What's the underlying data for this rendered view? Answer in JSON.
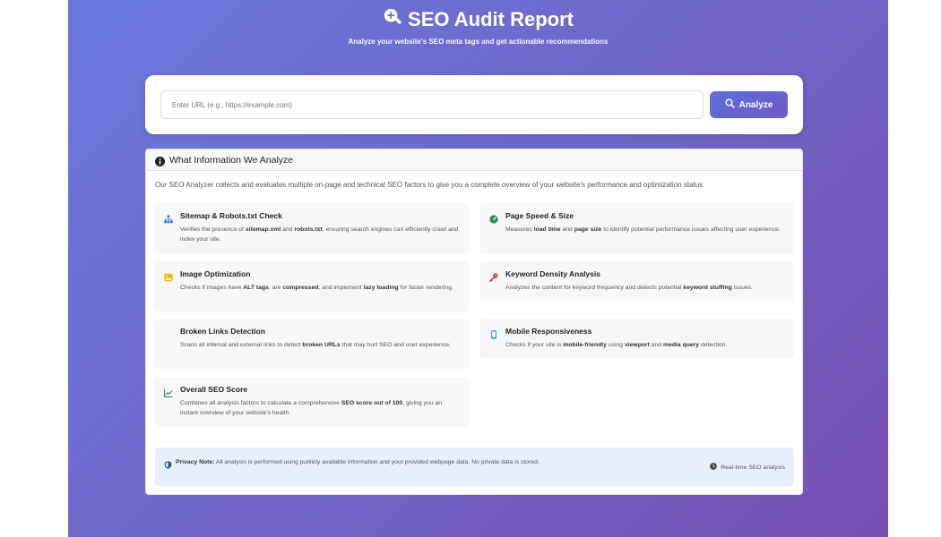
{
  "header": {
    "title": "SEO Audit Report",
    "subtitle": "Analyze your website's SEO meta tags and get actionable recommendations"
  },
  "search": {
    "placeholder": "Enter URL (e.g., https://example.com)",
    "value": "",
    "button_label": "Analyze"
  },
  "info": {
    "heading": "What Information We Analyze",
    "intro": "Our SEO Analyzer collects and evaluates multiple on-page and technical SEO factors to give you a complete overview of your website's performance and optimization status.",
    "features": [
      {
        "title": "Sitemap & Robots.txt Check",
        "desc_parts": [
          "Verifies the presence of ",
          "sitemap.xml",
          " and ",
          "robots.txt",
          ", ensuring search engines can efficiently crawl and index your site."
        ],
        "icon": "sitemap-icon"
      },
      {
        "title": "Page Speed & Size",
        "desc_parts": [
          "Measures ",
          "load time",
          " and ",
          "page size",
          " to identify potential performance issues affecting user experience."
        ],
        "icon": "speed-icon"
      },
      {
        "title": "Image Optimization",
        "desc_parts": [
          "Checks if images have ",
          "ALT tags",
          ", are ",
          "compressed",
          ", and implement ",
          "lazy loading",
          " for faster rendering."
        ],
        "icon": "image-icon"
      },
      {
        "title": "Keyword Density Analysis",
        "desc_parts": [
          "Analyzes the content for keyword frequency and detects potential ",
          "keyword stuffing",
          " issues."
        ],
        "icon": "key-icon"
      },
      {
        "title": "Broken Links Detection",
        "desc_parts": [
          "Scans all internal and external links to detect ",
          "broken URLs",
          " that may hurt SEO and user experience."
        ],
        "icon": "none"
      },
      {
        "title": "Mobile Responsiveness",
        "desc_parts": [
          "Checks if your site is ",
          "mobile-friendly",
          " using ",
          "viewport",
          " and ",
          "media query",
          " detection."
        ],
        "icon": "mobile-icon"
      },
      {
        "title": "Overall SEO Score",
        "desc_parts": [
          "Combines all analysis factors to calculate a comprehensive ",
          "SEO score out of 100",
          ", giving you an instant overview of your website's health."
        ],
        "icon": "chart-line-icon"
      }
    ]
  },
  "privacy": {
    "label": "Privacy Note:",
    "text": " All analysis is performed using publicly available information and your provided webpage data. No private data is stored.",
    "realtime": "Real-time SEO analysis"
  },
  "colors": {
    "gradient_start": "#6a78dc",
    "gradient_end": "#7650b0",
    "accent": "#5b6fd8"
  }
}
